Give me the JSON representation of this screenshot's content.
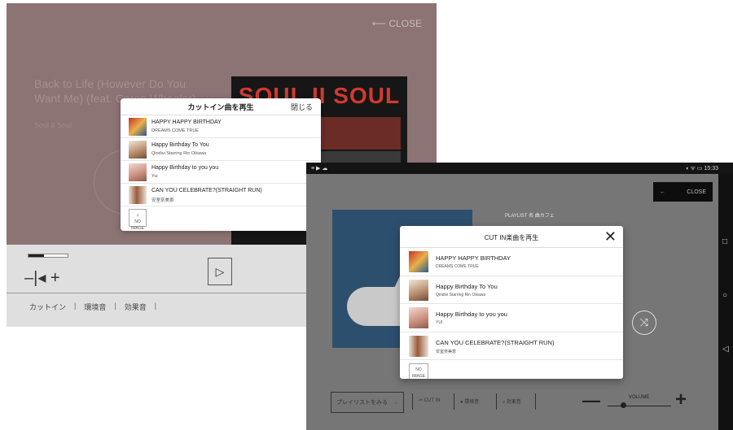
{
  "screen_a": {
    "back_text": "CLOSE",
    "track_title": "Back to Life (However Do You Want Me) (feat. Caron Wheeler)",
    "artist": "Soul II Soul",
    "album_art_text": "SOUL II SOUL",
    "progress": 0.4,
    "volume_label": "–|◂ +",
    "tabs": [
      "カットイン",
      "環境音",
      "効果音"
    ],
    "modal": {
      "title": "カットイン曲を再生",
      "close_label": "閉じる",
      "items": [
        {
          "title": "HAPPY HAPPY BIRTHDAY",
          "artist": "DREAMS COME TRUE"
        },
        {
          "title": "Happy Birthday To You",
          "artist": "Qindivi Starring Rin Oikawa"
        },
        {
          "title": "Happy Birthday to you you",
          "artist": "Yui"
        },
        {
          "title": "CAN YOU CELEBRATE?(STRAIGHT RUN)",
          "artist": "安室奈美恵"
        },
        {
          "title": "",
          "artist": "",
          "thumb_text": "NO IMAGE"
        }
      ]
    }
  },
  "screen_b": {
    "status_left": "≡ ▶ ☁",
    "status_right": "◖ ᯤ ▭ 15:33",
    "close_button": {
      "arrow": "←",
      "label": "CLOSE"
    },
    "meta_line": "PLAYLIST 名 曲カフェ",
    "modal": {
      "title": "CUT IN楽曲を再生",
      "close_glyph": "✕",
      "items": [
        {
          "title": "HAPPY HAPPY BIRTHDAY",
          "artist": "DREAMS COME TRUE"
        },
        {
          "title": "Happy Birthday To You",
          "artist": "Qindivi Starring Rin Oikawa"
        },
        {
          "title": "Happy Birthday to you you",
          "artist": "YUI"
        },
        {
          "title": "CAN YOU CELEBRATE?(STRAIGHT RUN)",
          "artist": "安室奈美恵"
        },
        {
          "title": "",
          "artist": "",
          "thumb_text": "NO IMAGE"
        }
      ]
    },
    "shuffle_glyph": "⤨",
    "playlist_button": {
      "label": "プレイリストをみる",
      "arrow": "→"
    },
    "tabs": [
      {
        "icon": "✂",
        "label": "CUT IN"
      },
      {
        "icon": "●",
        "label": "環境音"
      },
      {
        "icon": "♪",
        "label": "効果音"
      }
    ],
    "volume_label": "VOLUME",
    "minus_glyph": "—",
    "plus_glyph": "+",
    "nav": {
      "square": "□",
      "circle": "○",
      "back": "◁"
    }
  },
  "colors": {
    "screen_a_dim": "#8c7374",
    "screen_b_dim": "#767676",
    "modal_bg": "#ffffff",
    "album_red": "#d13a30"
  }
}
